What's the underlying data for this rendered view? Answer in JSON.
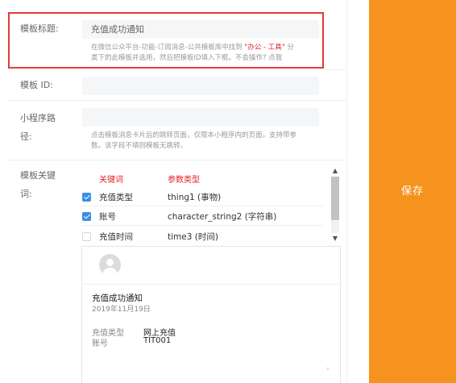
{
  "form": {
    "template_title": {
      "label": "模板标题:",
      "value": "充值成功通知",
      "hint_prefix": "在微信公众平台-功能-订阅消息-公共模板库中找到 ",
      "hint_highlight": "\"办公 - 工具\"",
      "hint_suffix": " 分",
      "hint_line2": "类下的此模板并选用，然后把模板ID填入下框。不会操作? 点我"
    },
    "template_id": {
      "label": "模板  ID:",
      "value": ""
    },
    "mini_program_path": {
      "label_line1": "小程序路",
      "label_line2": "径:",
      "value": "",
      "hint_line1": "点击模板消息卡片后的跳转页面，仅限本小程序内的页面，支持带参",
      "hint_line2": "数。该字段不填则模板无跳转。"
    },
    "keywords": {
      "label_line1": "模板关键",
      "label_line2": "词:",
      "col_keyword": "关键词",
      "col_param_type": "参数类型",
      "rows": [
        {
          "keyword": "充值类型",
          "param": "thing1 (事物)",
          "checked": true
        },
        {
          "keyword": "账号",
          "param": "character_string2 (字符串)",
          "checked": true
        },
        {
          "keyword": "充值时间",
          "param": "time3 (时间)",
          "checked": false
        }
      ]
    }
  },
  "preview": {
    "title": "充值成功通知",
    "date": "2019年11月19日",
    "fields": [
      {
        "key": "充值类型",
        "value": "网上充值"
      },
      {
        "key": "账号",
        "value": "TIT001"
      }
    ],
    "chevron": "›"
  },
  "scrollbar": {
    "up": "▲",
    "down": "▼"
  },
  "actions": {
    "save_label": "保存"
  },
  "colors": {
    "accent": "#f6921e",
    "highlight": "#e02020",
    "checkbox": "#3a8ee6"
  }
}
